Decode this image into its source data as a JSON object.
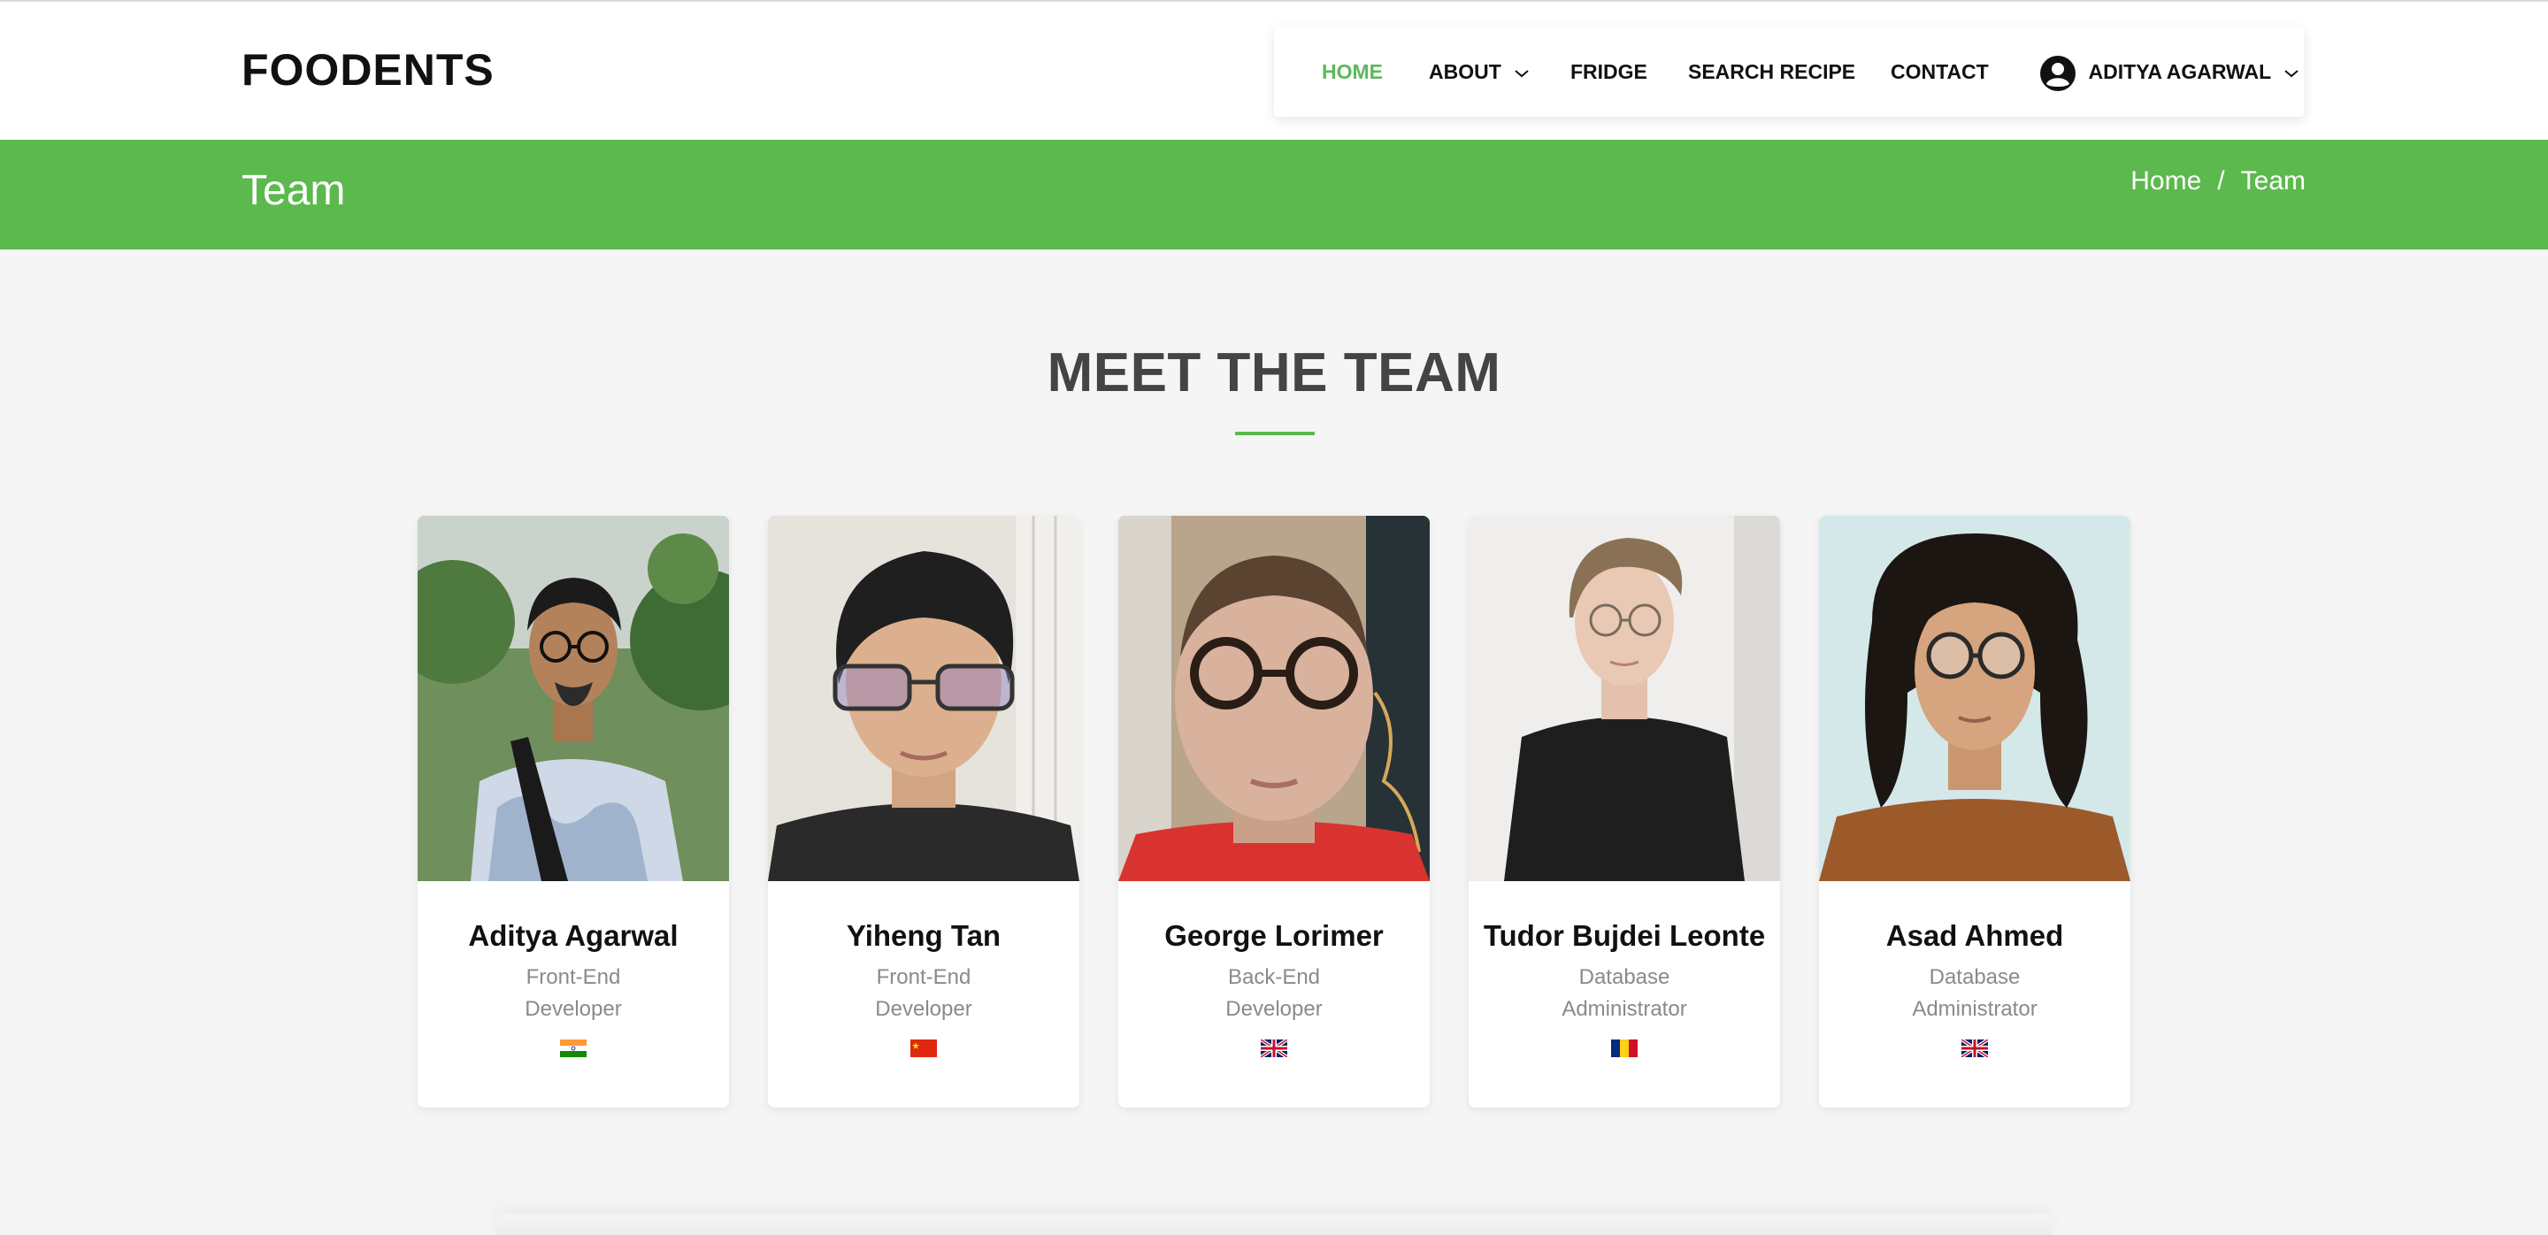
{
  "brand": "FOODENTS",
  "nav": {
    "home": "HOME",
    "about": "ABOUT",
    "fridge": "FRIDGE",
    "search": "SEARCH RECIPE",
    "contact": "CONTACT",
    "user": "ADITYA AGARWAL"
  },
  "banner": {
    "title": "Team",
    "breadcrumb": {
      "home": "Home",
      "separator": "/",
      "current": "Team"
    }
  },
  "section": {
    "title": "MEET THE TEAM"
  },
  "team": [
    {
      "name": "Aditya Agarwal",
      "role_line1": "Front-End",
      "role_line2": "Developer",
      "flag_icon": "india-flag-icon"
    },
    {
      "name": "Yiheng Tan",
      "role_line1": "Front-End",
      "role_line2": "Developer",
      "flag_icon": "china-flag-icon"
    },
    {
      "name": "George Lorimer",
      "role_line1": "Back-End",
      "role_line2": "Developer",
      "flag_icon": "uk-flag-icon"
    },
    {
      "name": "Tudor Bujdei Leonte",
      "role_line1": "Database",
      "role_line2": "Administrator",
      "flag_icon": "romania-flag-icon"
    },
    {
      "name": "Asad Ahmed",
      "role_line1": "Database",
      "role_line2": "Administrator",
      "flag_icon": "uk-flag-icon"
    }
  ],
  "colors": {
    "accent": "#5cb94d",
    "active_nav": "#5cb85c",
    "background": "#f5f5f5"
  }
}
